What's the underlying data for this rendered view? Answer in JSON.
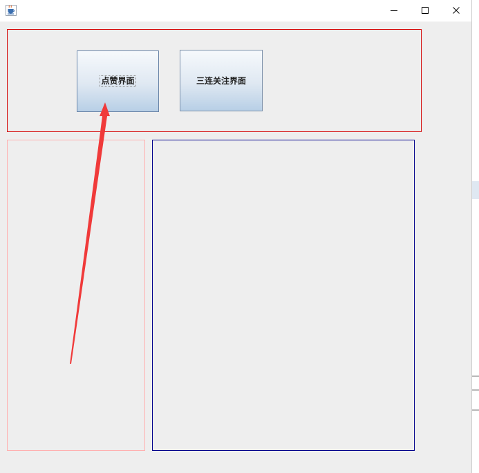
{
  "window": {
    "app_icon": "java-coffee-icon",
    "controls": {
      "minimize_icon": "minimize-icon",
      "maximize_icon": "maximize-icon",
      "close_icon": "close-icon"
    }
  },
  "toolbar": {
    "like_button_label": "点赞界面",
    "triple_button_label": "三连关注界面"
  },
  "colors": {
    "top_panel_border": "#d40000",
    "left_panel_border": "#ffb0b0",
    "main_panel_border": "#00008b",
    "annotation_arrow": "#f03a3a",
    "window_background": "#eeeeee"
  }
}
